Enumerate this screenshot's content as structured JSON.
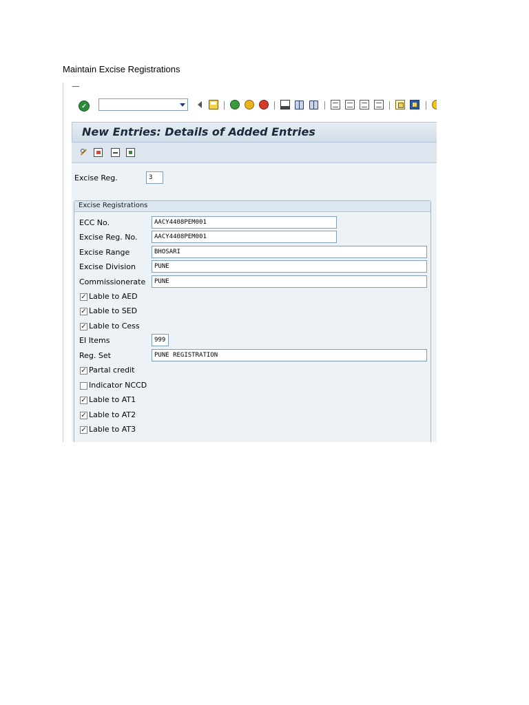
{
  "document": {
    "heading": "Maintain Excise Registrations"
  },
  "screen": {
    "title": "New Entries: Details of Added Entries",
    "command_field_value": "",
    "excise_reg": {
      "label": "Excise Reg.",
      "value": "3"
    },
    "group": {
      "title": "Excise Registrations",
      "fields": [
        {
          "label": "ECC No.",
          "value": "AACY4408PEM001"
        },
        {
          "label": "Excise Reg. No.",
          "value": "AACY4408PEM001"
        },
        {
          "label": "Excise Range",
          "value": "BHOSARI"
        },
        {
          "label": "Excise Division",
          "value": "PUNE"
        },
        {
          "label": "Commissionerate",
          "value": "PUNE"
        }
      ],
      "checks_a": [
        {
          "label": "Lable to AED",
          "checked": true
        },
        {
          "label": "Lable to SED",
          "checked": true
        },
        {
          "label": "Lable to Cess",
          "checked": true
        }
      ],
      "ei_items": {
        "label": "EI Items",
        "value": "999"
      },
      "reg_set": {
        "label": "Reg. Set",
        "value": "PUNE REGISTRATION"
      },
      "checks_b": [
        {
          "label": "Partal credit",
          "checked": true
        },
        {
          "label": "Indicator NCCD",
          "checked": false
        },
        {
          "label": "Lable to AT1",
          "checked": true
        },
        {
          "label": "Lable to AT2",
          "checked": true
        },
        {
          "label": "Lable to AT3",
          "checked": true
        }
      ]
    }
  },
  "check_glyph": "✓",
  "icons": {
    "standard_toolbar": [
      "enter-icon",
      "back-arrow-icon",
      "save-icon",
      "back-icon",
      "exit-icon",
      "cancel-icon",
      "print-icon",
      "find-icon",
      "find-next-icon",
      "first-page-icon",
      "previous-page-icon",
      "next-page-icon",
      "last-page-icon",
      "create-session-icon",
      "shortcut-icon",
      "help-icon"
    ],
    "application_toolbar": [
      "change-icon",
      "new-entry-icon",
      "previous-entry-icon",
      "next-entry-icon"
    ]
  }
}
